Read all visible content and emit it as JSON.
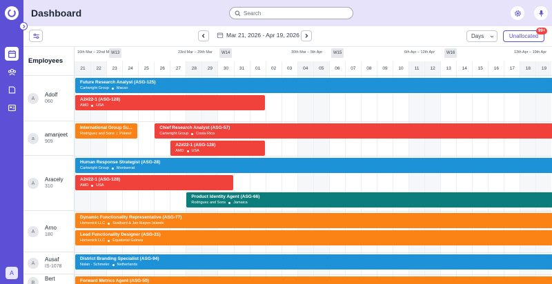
{
  "app": {
    "title": "Dashboard",
    "user_initial": "A"
  },
  "search": {
    "placeholder": "Search"
  },
  "colors": {
    "accent": "#5b50d6",
    "blue": "#1d92d6",
    "red": "#f0413a",
    "orange": "#fb8315",
    "teal": "#0b7d7a"
  },
  "toolbar": {
    "date_range": "Mar 21, 2026 - Apr 19, 2026",
    "view_select": "Days",
    "unallocated_label": "Unallocated",
    "unallocated_badge": "99+"
  },
  "grid": {
    "employees_header": "Employees"
  },
  "weeks": [
    {
      "range": "16th Mar – 22nd Mar",
      "tag": "W13"
    },
    {
      "range": "23rd Mar – 29th Mar",
      "tag": "W14"
    },
    {
      "range": "30th Mar – 5th Apr",
      "tag": "W15"
    },
    {
      "range": "6th Apr – 12th Apr",
      "tag": "W16"
    },
    {
      "range": "13th Apr – 19th Apr",
      "tag": ""
    }
  ],
  "days": [
    "21",
    "22",
    "23",
    "24",
    "25",
    "26",
    "27",
    "28",
    "29",
    "30",
    "31",
    "01",
    "02",
    "03",
    "04",
    "05",
    "06",
    "07",
    "08",
    "09",
    "10",
    "11",
    "12",
    "13",
    "14",
    "15",
    "16",
    "17",
    "18",
    "19"
  ],
  "employees": [
    {
      "initial": "A",
      "name": "Adolf",
      "id": "060"
    },
    {
      "initial": "a",
      "name": "amanjeet",
      "id": "909"
    },
    {
      "initial": "A",
      "name": "Aracely",
      "id": "310"
    },
    {
      "initial": "A",
      "name": "Arno",
      "id": "180"
    },
    {
      "initial": "A",
      "name": "Ausaf",
      "id": "IS-1078"
    },
    {
      "initial": "B",
      "name": "Bert",
      "id": ""
    }
  ],
  "assignments": [
    {
      "title": "Future Research Analyst (ASG-125)",
      "company": "Cartwright Group",
      "location": "Macao",
      "sep": "dot",
      "color": "blue",
      "start": 0,
      "end": 30,
      "row": 0,
      "lane": 0
    },
    {
      "title": "A2#22-1 (ASG-128)",
      "company": "AMD",
      "location": "USA",
      "sep": "dot",
      "color": "red",
      "start": 0,
      "end": 12,
      "row": 0,
      "lane": 1
    },
    {
      "title": "International Group Su...",
      "company": "Rodriguez and Sons",
      "location": "Poland",
      "sep": "pipe",
      "color": "orange",
      "start": 0,
      "end": 4,
      "row": 1,
      "lane": 0
    },
    {
      "title": "Chief Research Analyst (ASG-57)",
      "company": "Cartwright Group",
      "location": "Costa Rica",
      "sep": "dot",
      "color": "red",
      "start": 5,
      "end": 30,
      "row": 1,
      "lane": 0
    },
    {
      "title": "A2#22-1 (ASG-128)",
      "company": "AMD",
      "location": "USA",
      "sep": "dot",
      "color": "red",
      "start": 6,
      "end": 12,
      "row": 1,
      "lane": 1
    },
    {
      "title": "Human Response Strategist (ASG-28)",
      "company": "Cartwright Group",
      "location": "Montserrat",
      "sep": "dot",
      "color": "blue",
      "start": 0,
      "end": 30,
      "row": 2,
      "lane": 0
    },
    {
      "title": "A2#22-1 (ASG-128)",
      "company": "AMD",
      "location": "USA",
      "sep": "dot",
      "color": "red",
      "start": 0,
      "end": 10,
      "row": 2,
      "lane": 1
    },
    {
      "title": "Product Identity Agent (ASG-66)",
      "company": "Rodriguez and Sons",
      "location": "Jamaica",
      "sep": "dot",
      "color": "teal",
      "start": 7,
      "end": 30,
      "row": 2,
      "lane": 2
    },
    {
      "title": "Dynamic Functionality Representative (ASG-77)",
      "company": "Homenick LLC",
      "location": "Svalbard & Jan Mayen Islands",
      "sep": "dot",
      "color": "orange",
      "start": 0,
      "end": 30,
      "row": 3,
      "lane": 0
    },
    {
      "title": "Lead Functionality Designer (ASG-21)",
      "company": "Homenick LLC",
      "location": "Equatorial Guinea",
      "sep": "dot",
      "color": "orange",
      "start": 0,
      "end": 30,
      "row": 3,
      "lane": 1
    },
    {
      "title": "District Branding Specialist (ASG-94)",
      "company": "Nolan - Schmeler",
      "location": "Netherlands",
      "sep": "dot",
      "color": "blue",
      "start": 0,
      "end": 30,
      "row": 4,
      "lane": 0
    },
    {
      "title": "Forward Metrics Agent (ASG-50)",
      "company": "",
      "location": "",
      "sep": "dot",
      "color": "orange",
      "start": 0,
      "end": 30,
      "row": 5,
      "lane": 0
    }
  ]
}
